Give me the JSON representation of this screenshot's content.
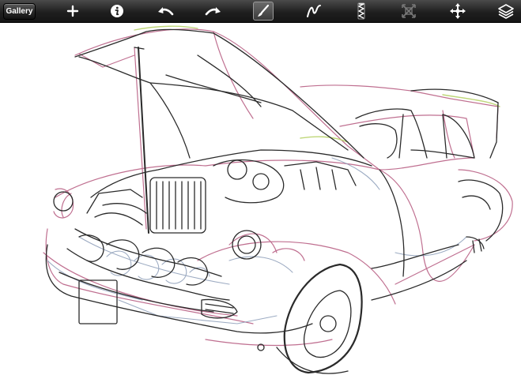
{
  "toolbar": {
    "gallery_label": "Gallery",
    "tools": [
      {
        "name": "add",
        "icon": "plus-icon"
      },
      {
        "name": "info",
        "icon": "info-icon"
      },
      {
        "name": "undo",
        "icon": "undo-icon"
      },
      {
        "name": "redo",
        "icon": "redo-icon"
      },
      {
        "name": "brush",
        "icon": "brush-icon",
        "active": true
      },
      {
        "name": "smudge",
        "icon": "smudge-icon"
      },
      {
        "name": "eraser",
        "icon": "eraser-icon"
      },
      {
        "name": "transform",
        "icon": "transform-icon",
        "disabled": true
      },
      {
        "name": "move",
        "icon": "move-icon"
      },
      {
        "name": "layers",
        "icon": "layers-icon"
      }
    ]
  },
  "canvas": {
    "subject": "sketch-drawing",
    "stroke_colors": [
      "#2a2a2a",
      "#b5577d",
      "#8c9db8",
      "#b8d36a"
    ]
  }
}
